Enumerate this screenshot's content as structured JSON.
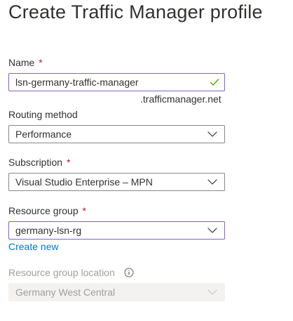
{
  "page": {
    "title": "Create Traffic Manager profile"
  },
  "name": {
    "label": "Name",
    "required_mark": "*",
    "value": "lsn-germany-traffic-manager",
    "suffix": ".trafficmanager.net",
    "valid_icon": "checkmark-icon"
  },
  "routing": {
    "label": "Routing method",
    "selected": "Performance",
    "icon": "chevron-down-icon"
  },
  "subscription": {
    "label": "Subscription",
    "required_mark": "*",
    "selected": "Visual Studio Enterprise – MPN",
    "icon": "chevron-down-icon"
  },
  "resource_group": {
    "label": "Resource group",
    "required_mark": "*",
    "selected": "germany-lsn-rg",
    "icon": "chevron-down-icon",
    "create_new_label": "Create new"
  },
  "location": {
    "label": "Resource group location",
    "info_icon": "info-icon",
    "selected": "Germany West Central",
    "disabled": true,
    "icon": "chevron-down-icon"
  },
  "colors": {
    "required": "#a4262c",
    "link": "#0078d4",
    "focus_border": "#8661c5",
    "valid_check": "#57a300",
    "disabled_text": "#a19f9d",
    "disabled_bg": "#f3f2f1"
  }
}
